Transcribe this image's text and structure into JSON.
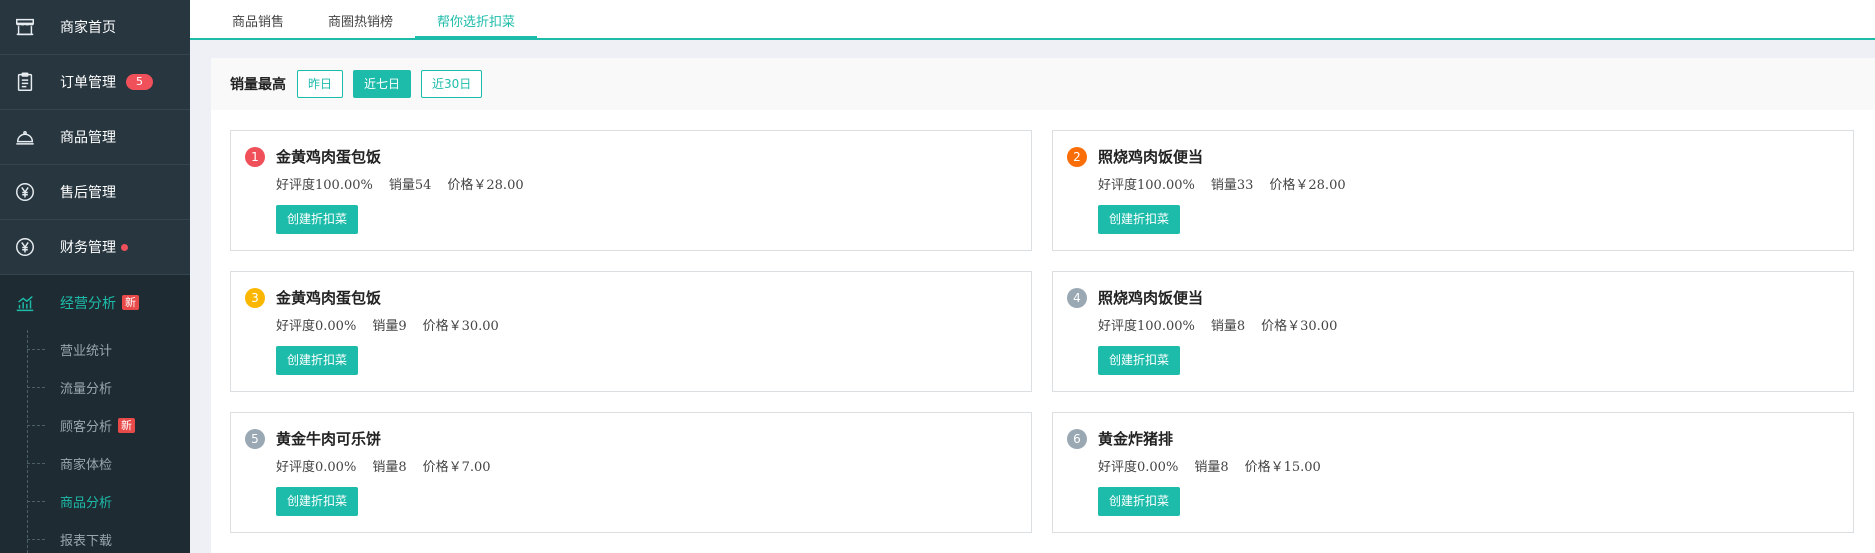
{
  "sidebar": {
    "items": [
      {
        "label": "商家首页",
        "icon": "store-icon"
      },
      {
        "label": "订单管理",
        "icon": "clipboard-icon",
        "badge": "5"
      },
      {
        "label": "商品管理",
        "icon": "cloche-icon"
      },
      {
        "label": "售后管理",
        "icon": "yen-circle-icon"
      },
      {
        "label": "财务管理",
        "icon": "yen-circle-icon",
        "dot": true
      },
      {
        "label": "经营分析",
        "icon": "chart-icon",
        "new": "新"
      }
    ],
    "subitems": [
      {
        "label": "营业统计"
      },
      {
        "label": "流量分析"
      },
      {
        "label": "顾客分析",
        "new": "新"
      },
      {
        "label": "商家体检"
      },
      {
        "label": "商品分析"
      },
      {
        "label": "报表下载"
      }
    ]
  },
  "tabs": [
    "商品销售",
    "商圈热销榜",
    "帮你选折扣菜"
  ],
  "toolbar": {
    "title": "销量最高",
    "ranges": [
      "昨日",
      "近七日",
      "近30日"
    ],
    "selected_range": "近七日"
  },
  "colors": {
    "accent": "#1dbcaa",
    "sidebar_bg": "#27363f",
    "rank1": "#f0505a",
    "rank2": "#fa6e0a",
    "rank3": "#fbb700",
    "rank_other": "#9aa8b4"
  },
  "products": [
    {
      "rank": "1",
      "name": "金黄鸡肉蛋包饭",
      "rating": "好评度100.00%",
      "sales": "销量54",
      "price": "价格￥28.00",
      "button": "创建折扣菜"
    },
    {
      "rank": "2",
      "name": "照烧鸡肉饭便当",
      "rating": "好评度100.00%",
      "sales": "销量33",
      "price": "价格￥28.00",
      "button": "创建折扣菜"
    },
    {
      "rank": "3",
      "name": "金黄鸡肉蛋包饭",
      "rating": "好评度0.00%",
      "sales": "销量9",
      "price": "价格￥30.00",
      "button": "创建折扣菜"
    },
    {
      "rank": "4",
      "name": "照烧鸡肉饭便当",
      "rating": "好评度100.00%",
      "sales": "销量8",
      "price": "价格￥30.00",
      "button": "创建折扣菜"
    },
    {
      "rank": "5",
      "name": "黄金牛肉可乐饼",
      "rating": "好评度0.00%",
      "sales": "销量8",
      "price": "价格￥7.00",
      "button": "创建折扣菜"
    },
    {
      "rank": "6",
      "name": "黄金炸猪排",
      "rating": "好评度0.00%",
      "sales": "销量8",
      "price": "价格￥15.00",
      "button": "创建折扣菜"
    }
  ]
}
